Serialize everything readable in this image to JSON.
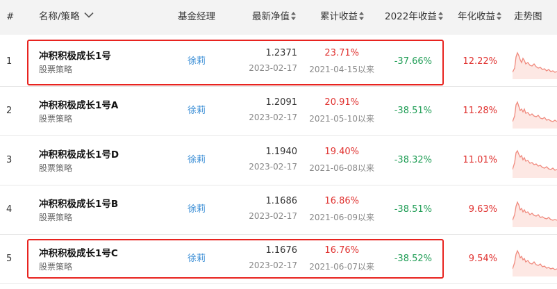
{
  "header": {
    "index": "#",
    "name_strategy": "名称/策略",
    "manager": "基金经理",
    "latest_nav": "最新净值",
    "cumulative_return": "累计收益",
    "return_2022": "2022年收益",
    "annualized_return": "年化收益",
    "trend": "走势图"
  },
  "rows": [
    {
      "index": "1",
      "name": "冲积积极成长1号",
      "strategy": "股票策略",
      "manager": "徐莉",
      "nav": "1.2371",
      "nav_date": "2023-02-17",
      "cum_return": "23.71%",
      "since": "2021-04-15以来",
      "return_2022": "-37.66%",
      "annualized": "12.22%"
    },
    {
      "index": "2",
      "name": "冲积积极成长1号A",
      "strategy": "股票策略",
      "manager": "徐莉",
      "nav": "1.2091",
      "nav_date": "2023-02-17",
      "cum_return": "20.91%",
      "since": "2021-05-10以来",
      "return_2022": "-38.51%",
      "annualized": "11.28%"
    },
    {
      "index": "3",
      "name": "冲积积极成长1号D",
      "strategy": "股票策略",
      "manager": "徐莉",
      "nav": "1.1940",
      "nav_date": "2023-02-17",
      "cum_return": "19.40%",
      "since": "2021-06-08以来",
      "return_2022": "-38.32%",
      "annualized": "11.01%"
    },
    {
      "index": "4",
      "name": "冲积积极成长1号B",
      "strategy": "股票策略",
      "manager": "徐莉",
      "nav": "1.1686",
      "nav_date": "2023-02-17",
      "cum_return": "16.86%",
      "since": "2021-06-09以来",
      "return_2022": "-38.51%",
      "annualized": "9.63%"
    },
    {
      "index": "5",
      "name": "冲积积极成长1号C",
      "strategy": "股票策略",
      "manager": "徐莉",
      "nav": "1.1676",
      "nav_date": "2023-02-17",
      "cum_return": "16.76%",
      "since": "2021-06-07以来",
      "return_2022": "-38.52%",
      "annualized": "9.54%"
    }
  ],
  "colors": {
    "positive": "#e0312f",
    "negative": "#1f9d55",
    "link": "#3a8ed6",
    "highlight": "#e8231f",
    "sparkline": "#f08a7e",
    "sparkline_fill": "#fde8e4"
  },
  "icons": {
    "name_sort": "chevron-down-icon",
    "column_sort": "sort-arrows-icon"
  }
}
